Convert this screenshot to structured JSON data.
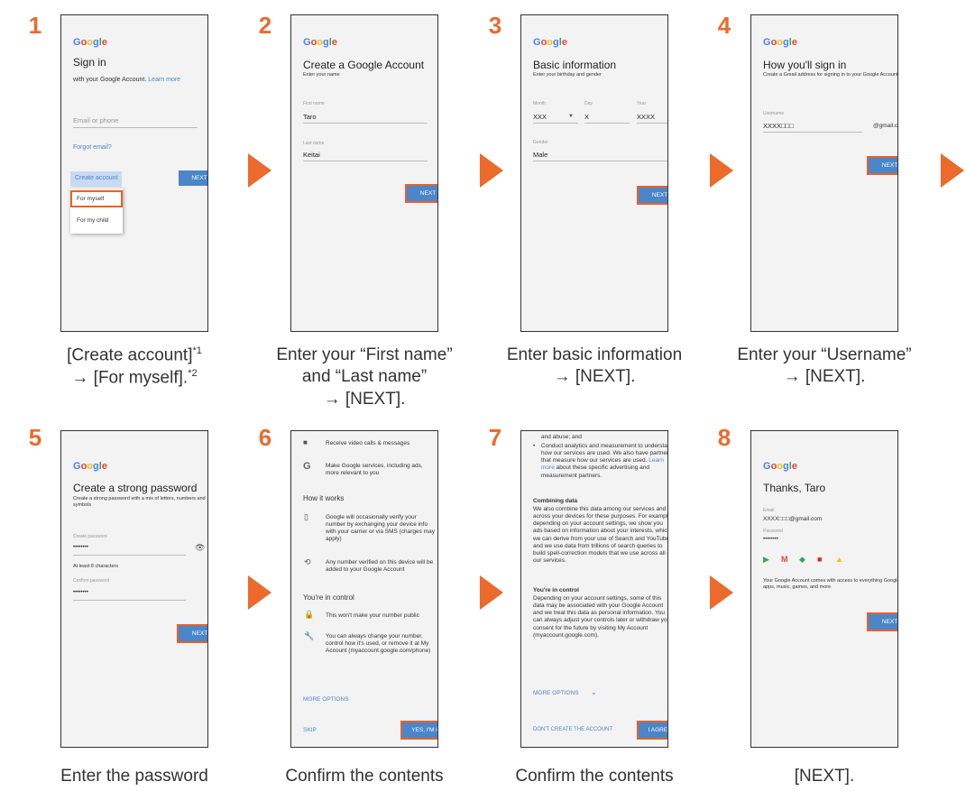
{
  "steps": [
    {
      "num": "1",
      "caption_lines": [
        "[Create account]",
        "*1",
        "→ [For myself].",
        "*2"
      ]
    },
    {
      "num": "2",
      "caption_lines": [
        "Enter your “First name”",
        "and “Last name”",
        "→ [NEXT]."
      ]
    },
    {
      "num": "3",
      "caption_lines": [
        "Enter basic information",
        "→ [NEXT]."
      ]
    },
    {
      "num": "4",
      "caption_lines": [
        "Enter your “Username”",
        "→ [NEXT]."
      ]
    },
    {
      "num": "5",
      "caption_lines": [
        "Enter the password"
      ]
    },
    {
      "num": "6",
      "caption_lines": [
        "Confirm the contents"
      ]
    },
    {
      "num": "7",
      "caption_lines": [
        "Confirm the contents"
      ]
    },
    {
      "num": "8",
      "caption_lines": [
        "[NEXT]."
      ]
    }
  ],
  "google_logo": [
    "G",
    "o",
    "o",
    "g",
    "l",
    "e"
  ],
  "screen1": {
    "title": "Sign in",
    "subtitle": "with your Google Account.",
    "learn_more": "Learn more",
    "email_placeholder": "Email or phone",
    "forgot_email": "Forgot email?",
    "create_account": "Create account",
    "next": "NEXT",
    "menu_items": [
      "For myself",
      "For my child"
    ]
  },
  "screen2": {
    "title": "Create a Google Account",
    "subtitle": "Enter your name",
    "first_name_label": "First name",
    "first_name_value": "Taro",
    "last_name_label": "Last name",
    "last_name_value": "Keitai",
    "next": "NEXT"
  },
  "screen3": {
    "title": "Basic information",
    "subtitle": "Enter your birthday and gender",
    "month_label": "Month",
    "month_value": "XXX",
    "day_label": "Day",
    "day_value": "X",
    "year_label": "Year",
    "year_value": "XXXX",
    "gender_label": "Gender",
    "gender_value": "Male",
    "next": "NEXT"
  },
  "screen4": {
    "title": "How you'll sign in",
    "subtitle": "Create a Gmail address for signing in to your Google Account",
    "username_label": "Username",
    "username_value": "XXXX□□□",
    "domain": "@gmail.com",
    "next": "NEXT"
  },
  "screen5": {
    "title": "Create a strong password",
    "subtitle": "Create a strong password with a mix of letters, numbers and symbols",
    "create_label": "Create password",
    "create_value": "••••••••",
    "hint": "At least 8 characters",
    "confirm_label": "Confirm password",
    "confirm_value": "••••••••",
    "next": "NEXT"
  },
  "screen6": {
    "item1": "Receive video calls & messages",
    "item2": "Make Google services, including ads, more relevant to you",
    "how_heading": "How it works",
    "item3": "Google will occasionally verify your number by exchanging your device info with your carrier or via SMS (charges may apply)",
    "item4": "Any number verified on this device will be added to your Google Account",
    "control_heading": "You're in control",
    "item5": "This won't make your number public",
    "item6": "You can always change your number, control how it's used, or remove it at My Account (myaccount.google.com/phone)",
    "more_options": "MORE OPTIONS",
    "skip": "SKIP",
    "yes": "YES, I'M IN"
  },
  "screen7": {
    "line_top": "and abuse; and",
    "bullet_text_a": "Conduct analytics and measurement to understand how our services are used. We also have partners that measure how our services are used.",
    "learn_more": "Learn more",
    "bullet_text_b": "about these specific advertising and measurement partners.",
    "combining_heading": "Combining data",
    "combining_text": "We also combine this data among our services and across your devices for these purposes. For example, depending on your account settings, we show you ads based on information about your interests, which we can derive from your use of Search and YouTube, and we use data from trillions of search queries to build spell-correction models that we use across all of our services.",
    "control_heading": "You're in control",
    "control_text": "Depending on your account settings, some of this data may be associated with your Google Account and we treat this data as personal information. You can always adjust your controls later or withdraw your consent for the future by visiting My Account (myaccount.google.com).",
    "more_options": "MORE OPTIONS",
    "dont_create": "DON'T CREATE THE ACCOUNT",
    "agree": "I AGREE"
  },
  "screen8": {
    "title": "Thanks, Taro",
    "email_label": "Email",
    "email_value": "XXXX□□□@gmail.com",
    "password_label": "Password",
    "password_value": "••••••••",
    "info": "Your Google Account comes with access to everything Google: apps, music, games, and more",
    "next": "NEXT"
  },
  "colors": {
    "accent": "#ec6a2c",
    "button": "#4a86c8",
    "highlight": "#e8612b"
  }
}
